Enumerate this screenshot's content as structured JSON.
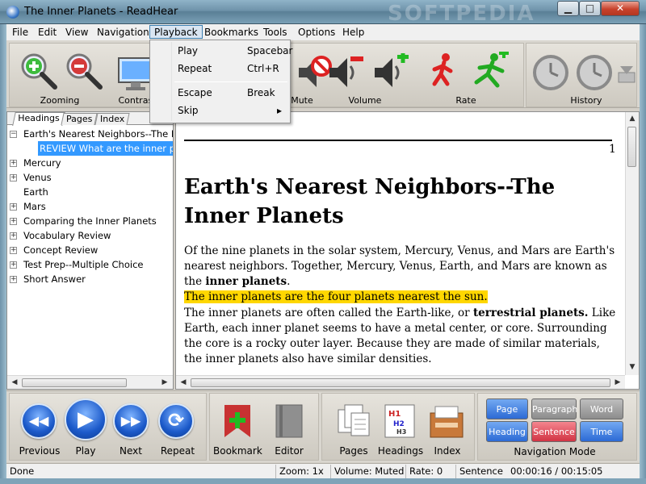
{
  "window": {
    "title": "The Inner Planets - ReadHear",
    "watermark": "SOFTPEDIA",
    "min_glyph": "▁",
    "max_glyph": "□",
    "close_glyph": "✕"
  },
  "menu": {
    "items": [
      "File",
      "Edit",
      "View",
      "Navigation",
      "Playback",
      "Bookmarks",
      "Tools",
      "Options",
      "Help"
    ],
    "active": "Playback"
  },
  "playback_menu": {
    "items": [
      {
        "label": "Play",
        "shortcut": "Spacebar"
      },
      {
        "label": "Repeat",
        "shortcut": "Ctrl+R"
      },
      {
        "label": "Escape",
        "shortcut": "Break"
      },
      {
        "label": "Skip",
        "shortcut": "▸"
      }
    ]
  },
  "toolbar": {
    "zooming": "Zooming",
    "contrast": "Contrast",
    "mute": "Mute",
    "volume": "Volume",
    "rate": "Rate",
    "history": "History"
  },
  "left_panel": {
    "tabs": [
      "Headings",
      "Pages",
      "Index"
    ],
    "active_tab": "Headings",
    "tree": [
      {
        "label": "Earth's Nearest Neighbors--The Inner Planets",
        "expander": "−",
        "level": 0
      },
      {
        "label": "REVIEW What are the inner planets?",
        "expander": "",
        "level": 1,
        "selected": true
      },
      {
        "label": "Mercury",
        "expander": "+",
        "level": 0
      },
      {
        "label": "Venus",
        "expander": "+",
        "level": 0
      },
      {
        "label": "Earth",
        "expander": "",
        "level": 0
      },
      {
        "label": "Mars",
        "expander": "+",
        "level": 0
      },
      {
        "label": "Comparing the Inner Planets",
        "expander": "+",
        "level": 0
      },
      {
        "label": "Vocabulary Review",
        "expander": "+",
        "level": 0
      },
      {
        "label": "Concept Review",
        "expander": "+",
        "level": 0
      },
      {
        "label": "Test Prep--Multiple Choice",
        "expander": "+",
        "level": 0
      },
      {
        "label": "Short Answer",
        "expander": "+",
        "level": 0
      }
    ]
  },
  "document": {
    "page_number": "1",
    "heading": "Earth's Nearest Neighbors--The Inner Planets",
    "p1_a": "Of the nine planets in the solar system, Mercury, Venus, and Mars are Earth's nearest neighbors. Together, Mercury, Venus, Earth, and Mars are known as the ",
    "p1_bold": "inner planets",
    "p1_b": ".",
    "p1_highlight": "The inner planets are the four planets nearest the sun.",
    "p2_a": "The inner planets are often called the Earth-like, or ",
    "p2_bold": "terrestrial planets.",
    "p2_b": " Like Earth, each inner planet seems to have a metal center, or core. Surrounding the core is a rocky outer layer. Because they are made of similar materials, the inner planets also have similar densities."
  },
  "bottom": {
    "previous": "Previous",
    "play": "Play",
    "next": "Next",
    "repeat": "Repeat",
    "bookmark": "Bookmark",
    "editor": "Editor",
    "pages": "Pages",
    "headings": "Headings",
    "index": "Index",
    "navigation_mode_label": "Navigation Mode",
    "modes": {
      "page": "Page",
      "paragraph": "Paragraph",
      "word": "Word",
      "heading": "Heading",
      "sentence": "Sentence",
      "time": "Time"
    }
  },
  "status": {
    "message": "Done",
    "zoom": "Zoom: 1x",
    "volume": "Volume: Muted",
    "rate": "Rate: 0",
    "mode": "Sentence",
    "time": "00:00:16 / 00:15:05"
  },
  "colors": {
    "highlight": "#ffd700",
    "selection": "#3399ff",
    "nav_blue": "#2c6ad5",
    "nav_red": "#d23444",
    "nav_gray": "#8d8d8d"
  }
}
